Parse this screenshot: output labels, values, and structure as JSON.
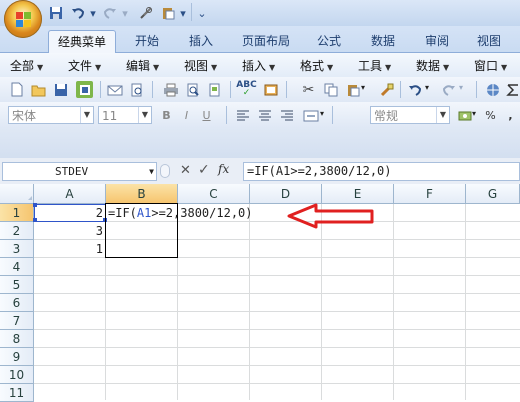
{
  "quick_access": {
    "dropdown_arrow": "▾",
    "overflow": "⌄"
  },
  "ribbon_tabs": [
    "经典菜单",
    "开始",
    "插入",
    "页面布局",
    "公式",
    "数据",
    "审阅",
    "视图"
  ],
  "menu_bar": [
    "全部",
    "文件",
    "编辑",
    "视图",
    "插入",
    "格式",
    "工具",
    "数据",
    "窗口"
  ],
  "toolbar": {
    "font_name": "宋体",
    "font_size": "11",
    "number_format": "常规",
    "percent": "%",
    "comma": ","
  },
  "formula_bar": {
    "name_box": "STDEV",
    "cancel": "✕",
    "enter": "✓",
    "fx": "fx",
    "formula": "=IF(A1>=2,3800/12,0)"
  },
  "sheet": {
    "columns": [
      "A",
      "B",
      "C",
      "D",
      "E",
      "F",
      "G"
    ],
    "rows": [
      "1",
      "2",
      "3",
      "4",
      "5",
      "6",
      "7",
      "8",
      "9",
      "10",
      "11"
    ],
    "cells": {
      "A1": "2",
      "A2": "3",
      "A3": "1",
      "B1_formula": {
        "eq": "=IF(",
        "ref": "A1",
        "rest": ">=2,3800/12,0)"
      }
    }
  },
  "colors": {
    "ref_highlight": "#2f55c9",
    "annotation_arrow": "#e02020",
    "selected_header": "#f6c56f"
  }
}
